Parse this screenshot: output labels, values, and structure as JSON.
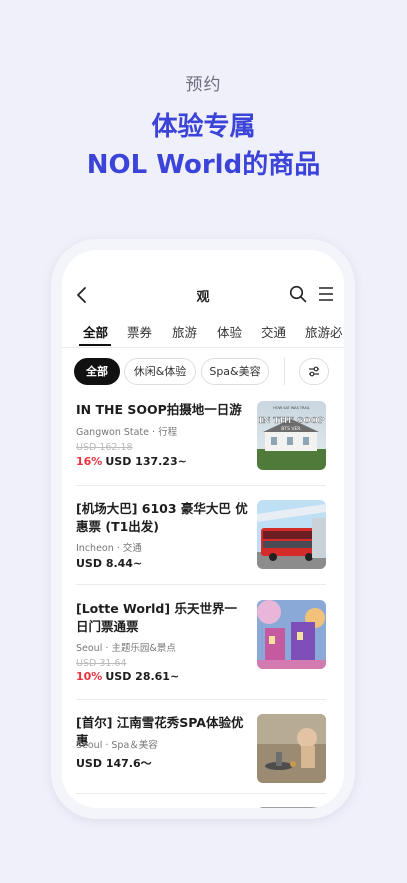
{
  "promo": {
    "eyebrow": "预约",
    "headline_line1": "体验专属",
    "headline_line2": "NOL World的商品"
  },
  "navbar": {
    "title": "观",
    "back_icon": "chevron-left-icon",
    "search_icon": "search-icon",
    "menu_icon": "hamburger-menu-icon"
  },
  "tabs": [
    "全部",
    "票券",
    "旅游",
    "体验",
    "交通",
    "旅游必"
  ],
  "active_tab": "全部",
  "chips": [
    "全部",
    "休闲&体验",
    "Spa&美容"
  ],
  "active_chip": "全部",
  "products": [
    {
      "title": "IN THE SOOP拍摄地一日游",
      "meta": "Gangwon State · 行程",
      "original_price": "USD 162.18",
      "discount": "16%",
      "price": "USD 137.23~"
    },
    {
      "title": "[机场大巴] 6103 豪华大巴 优惠票 (T1出发)",
      "meta": "Incheon · 交通",
      "original_price": "",
      "discount": "",
      "price": "USD 8.44~"
    },
    {
      "title": "[Lotte World] 乐天世界一日门票通票",
      "meta": "Seoul · 主题乐园&景点",
      "original_price": "USD 31.64",
      "discount": "10%",
      "price": "USD 28.61~"
    },
    {
      "title": "[首尔] 江南雪花秀SPA体验优惠",
      "meta": "Seoul · Spa＆美容",
      "original_price": "",
      "discount": "",
      "price": "USD 147.6～"
    }
  ],
  "thumb_text": {
    "soop_small": "HOW SAT WAS TRAIL",
    "soop_big": "IN THE SOOP",
    "soop_sub": "BTS VER."
  },
  "colors": {
    "background": "#eff0f9",
    "headline": "#3b43d8",
    "discount": "#e8343e"
  }
}
